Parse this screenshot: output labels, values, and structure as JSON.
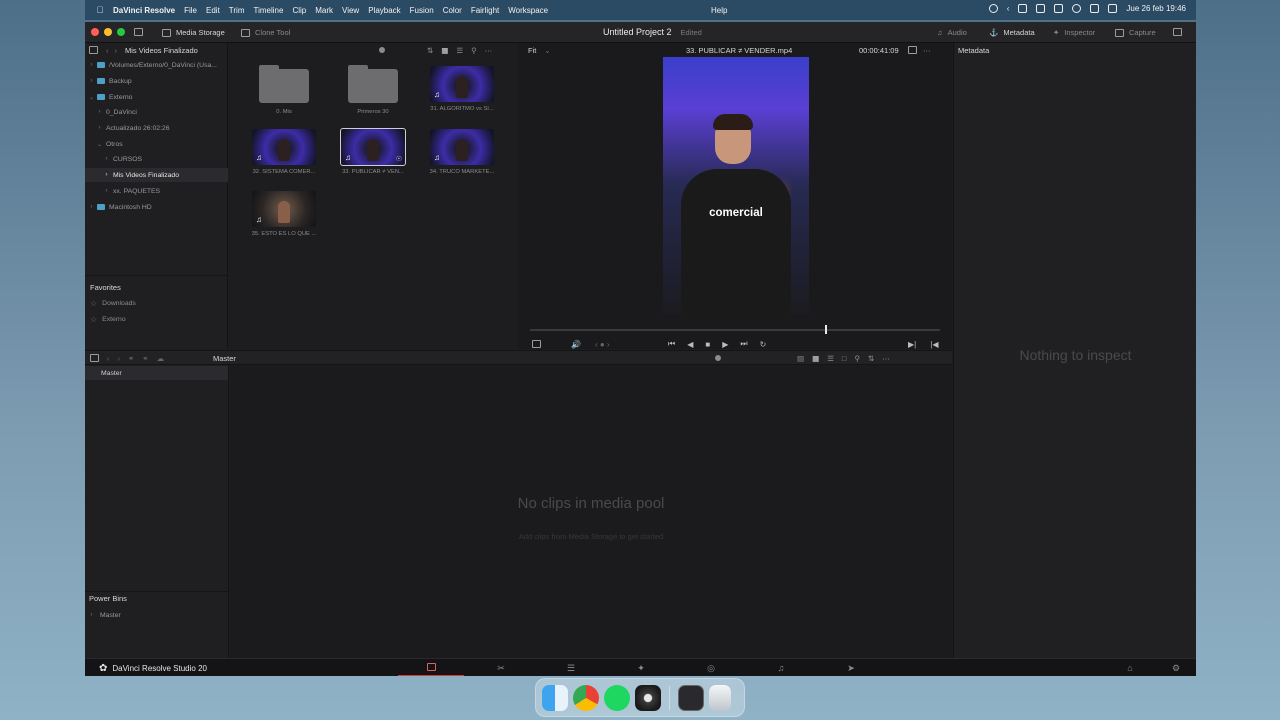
{
  "menubar": {
    "app": "DaVinci Resolve",
    "items": [
      "File",
      "Edit",
      "Trim",
      "Timeline",
      "Clip",
      "Mark",
      "View",
      "Playback",
      "Fusion",
      "Color",
      "Fairlight",
      "Workspace"
    ],
    "help": "Help",
    "datetime": "Jue 26 feb  19:46"
  },
  "titlebar": {
    "media_storage": "Media Storage",
    "clone_tool": "Clone Tool",
    "project": "Untitled Project 2",
    "status": "Edited",
    "tabs": [
      "Audio",
      "Metadata",
      "Inspector",
      "Capture"
    ]
  },
  "storage": {
    "title": "Mis Videos Finalizado",
    "tree": [
      {
        "label": "/Volumes/Externo/0_DaVinci (Usa..."
      },
      {
        "label": "Backup"
      },
      {
        "label": "Externo"
      },
      {
        "label": "0_DaVinci"
      },
      {
        "label": "Actualizado 26:02:26"
      },
      {
        "label": "Otros"
      },
      {
        "label": "CURSOS"
      },
      {
        "label": "Mis Videos Finalizado"
      },
      {
        "label": "xx. PAQUETES"
      },
      {
        "label": "Macintosh HD"
      }
    ],
    "favorites_title": "Favorites",
    "favorites": [
      "Downloads",
      "Externo"
    ]
  },
  "clips": [
    {
      "label": "0. Mis"
    },
    {
      "label": "Primeros 30"
    },
    {
      "label": "31. ALGORITMO vs SI..."
    },
    {
      "label": "32. SISTEMA COMER..."
    },
    {
      "label": "33. PUBLICAR ≠ VEN..."
    },
    {
      "label": "34. TRUCO MARKETE..."
    },
    {
      "label": "35. ESTO ES LO QUE ..."
    }
  ],
  "viewer": {
    "zoom": "Fit",
    "filename": "33. PUBLICAR ≠ VENDER.mp4",
    "timecode": "00:00:41:09",
    "caption": "comercial",
    "playhead_fraction": 0.72
  },
  "metadata": {
    "title": "Metadata",
    "empty": "Nothing to inspect"
  },
  "pool": {
    "bin": "Master",
    "master": "Master",
    "empty": "No clips in media pool",
    "empty_sub": "Add clips from Media Storage to get started",
    "power_bins": "Power Bins",
    "power_master": "Master"
  },
  "footer": {
    "brand": "DaVinci Resolve Studio 20",
    "pages": [
      "media",
      "cut",
      "edit",
      "fusion",
      "color",
      "fairlight",
      "deliver"
    ]
  },
  "dock": [
    "Finder",
    "Chrome",
    "Spotify",
    "DaVinci Resolve",
    "Screen Studio",
    "Trash"
  ]
}
